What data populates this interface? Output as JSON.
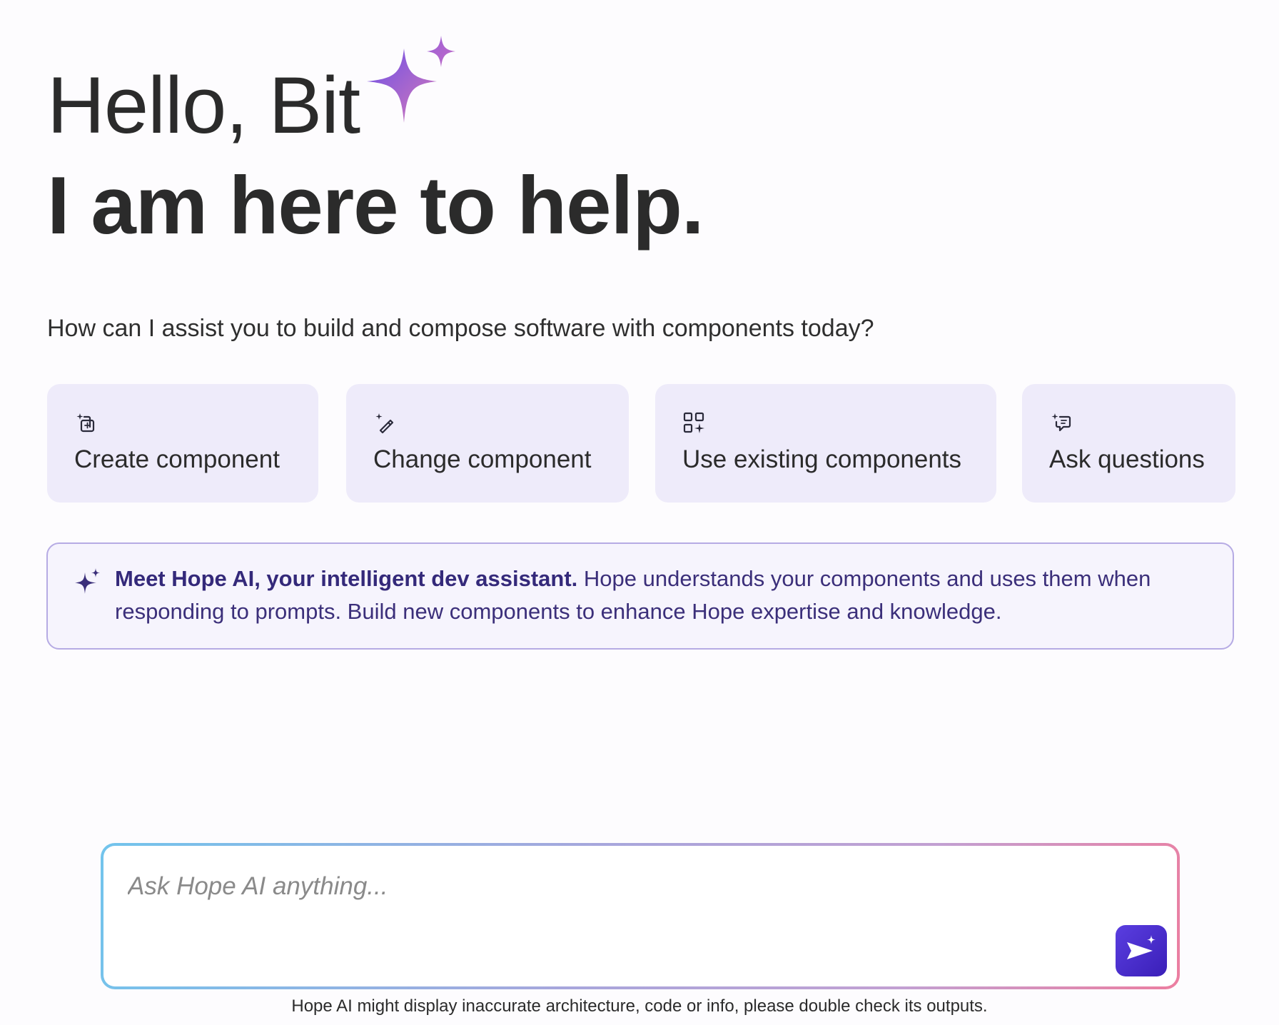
{
  "hero": {
    "greeting": "Hello, Bit",
    "headline": "I am here to help.",
    "subheading": "How can I assist you to build and compose software with components today?"
  },
  "actions": [
    {
      "label": "Create component",
      "icon": "create-component-icon"
    },
    {
      "label": "Change component",
      "icon": "magic-wand-icon"
    },
    {
      "label": "Use existing components",
      "icon": "component-grid-icon"
    },
    {
      "label": "Ask questions",
      "icon": "chat-sparkle-icon"
    }
  ],
  "info": {
    "bold": "Meet Hope AI, your intelligent dev assistant.",
    "text": " Hope understands your components and uses them when responding to prompts. Build new components to enhance Hope expertise and knowledge.",
    "icon": "sparkle-icon"
  },
  "composer": {
    "placeholder": "Ask Hope AI anything...",
    "send_icon": "send-sparkle-icon"
  },
  "footer": {
    "disclaimer": "Hope AI might display inaccurate architecture, code or info, please double check its outputs."
  },
  "colors": {
    "card_bg": "#eeebfa",
    "accent": "#3b2f7a",
    "send_button": "#4a2fd0",
    "sparkle_start": "#6a4ee8",
    "sparkle_end": "#d77ab8"
  }
}
